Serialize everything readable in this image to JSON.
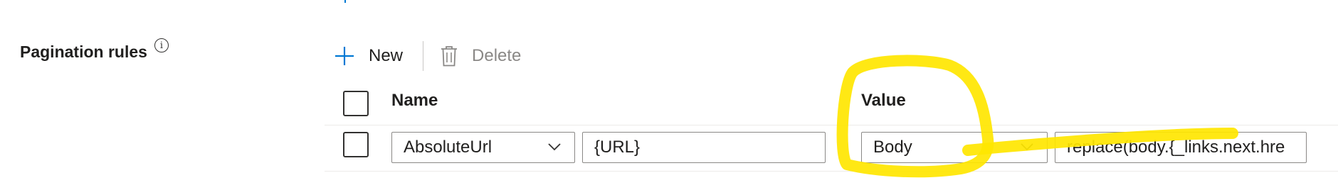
{
  "pagination": {
    "label": "Pagination rules",
    "info_glyph": "i"
  },
  "toolbar": {
    "new_label": "New",
    "delete_label": "Delete"
  },
  "table": {
    "columns": {
      "name": "Name",
      "value": "Value"
    },
    "rows": [
      {
        "name_select": "AbsoluteUrl",
        "name_text": "{URL}",
        "value_select": "Body",
        "value_text": "replace(body.{_links.next.hre"
      }
    ]
  },
  "colors": {
    "accent": "#0078d4",
    "highlight": "#ffe600",
    "disabled_text": "#8a8886",
    "border": "#8a8886"
  },
  "icons": {
    "new": "plus-icon",
    "delete": "trash-icon",
    "info": "info-icon",
    "dropdown": "chevron-down-icon"
  }
}
